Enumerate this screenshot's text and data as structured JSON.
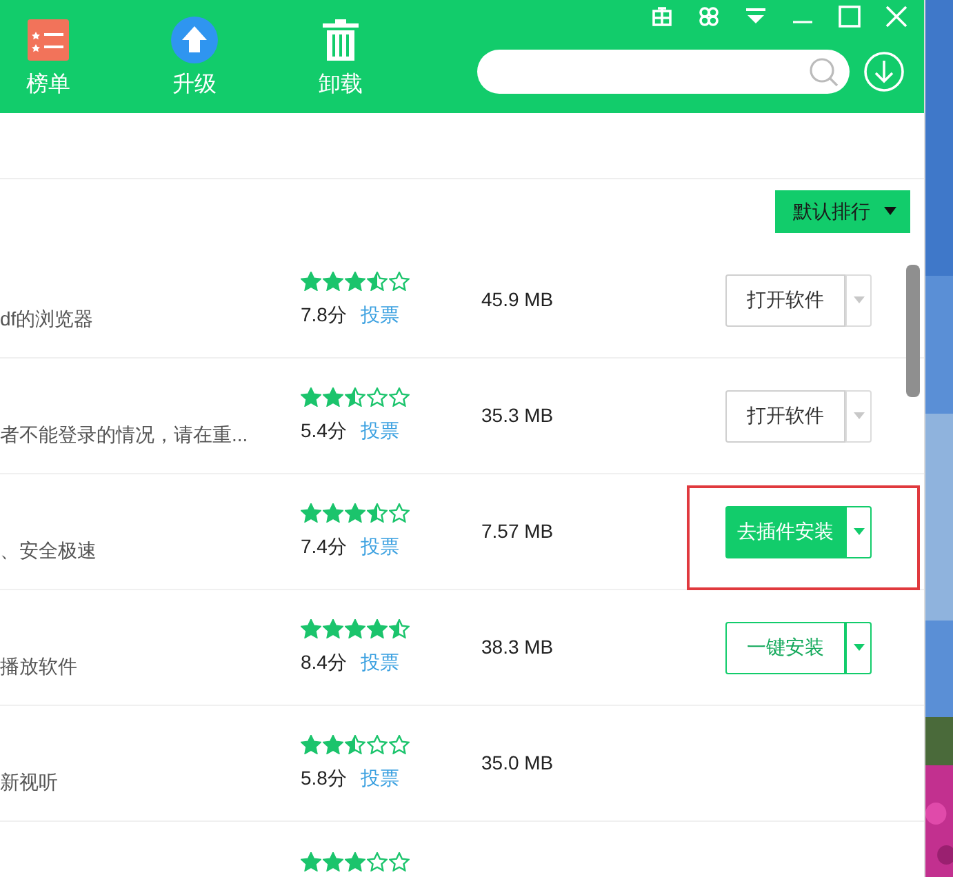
{
  "toolbar": {
    "items": [
      {
        "label": "榜单",
        "kind": "list"
      },
      {
        "label": "升级",
        "kind": "upgrade"
      },
      {
        "label": "卸载",
        "kind": "trash"
      }
    ]
  },
  "sort": {
    "label": "默认排行"
  },
  "rows": [
    {
      "description": "df的浏览器",
      "stars": 3.5,
      "score": "7.8分",
      "vote": "投票",
      "size": "45.9 MB",
      "action": {
        "label": "打开软件",
        "kind": "open",
        "highlighted": false
      }
    },
    {
      "description": "者不能登录的情况，请在重...",
      "stars": 2.5,
      "score": "5.4分",
      "vote": "投票",
      "size": "35.3 MB",
      "action": {
        "label": "打开软件",
        "kind": "open",
        "highlighted": false
      }
    },
    {
      "description": "、安全极速",
      "stars": 3.5,
      "score": "7.4分",
      "vote": "投票",
      "size": "7.57 MB",
      "action": {
        "label": "去插件安装",
        "kind": "plugin",
        "highlighted": true
      }
    },
    {
      "description": "播放软件",
      "stars": 4.5,
      "score": "8.4分",
      "vote": "投票",
      "size": "38.3 MB",
      "action": {
        "label": "一键安装",
        "kind": "install",
        "highlighted": false
      }
    },
    {
      "description": "新视听",
      "stars": 2.5,
      "score": "5.8分",
      "vote": "投票",
      "size": "35.0 MB"
    },
    {
      "stars": 3
    }
  ]
}
